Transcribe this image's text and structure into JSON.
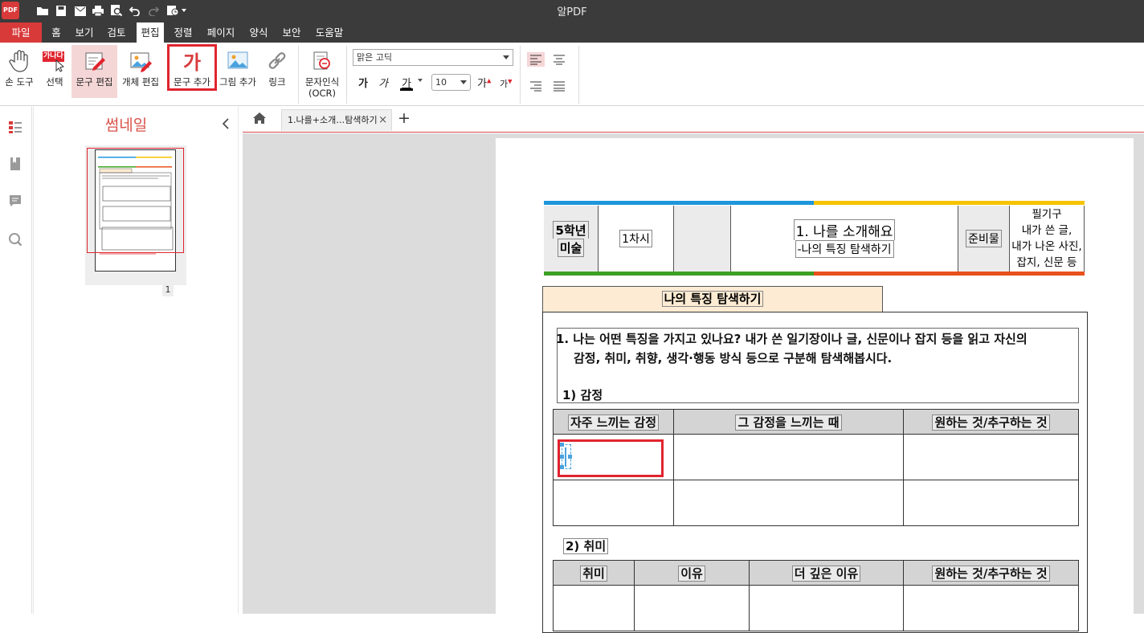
{
  "app": {
    "logo_text": "PDF",
    "title": "알PDF"
  },
  "menu": {
    "items": [
      "파일",
      "홈",
      "보기",
      "검토",
      "편집",
      "정렬",
      "페이지",
      "양식",
      "보안",
      "도움말"
    ],
    "active": "편집"
  },
  "ribbon": {
    "hand_tool": "손 도구",
    "select": "선택",
    "select_badge": "가나다",
    "text_edit": "문구 편집",
    "object_edit": "개체 편집",
    "add_text": "문구 추가",
    "add_text_glyph": "가",
    "add_image": "그림 추가",
    "link": "링크",
    "ocr_line1": "문자인식",
    "ocr_line2": "(OCR)",
    "font_name": "맑은 고딕",
    "font_size": "10",
    "bold_glyph": "가",
    "italic_glyph": "가",
    "underline_glyph": "가",
    "grow_glyph": "가",
    "shrink_glyph": "가"
  },
  "sidebar": {
    "title": "썸네일",
    "page_number": "1"
  },
  "tabs": {
    "doc_tab": "1.나를+소개…탐색하기",
    "close_glyph": "×",
    "add_glyph": "+"
  },
  "document": {
    "grade_line1": "5학년",
    "grade_line2": "미술",
    "period": "1차시",
    "lesson_title": "1. 나를 소개해요",
    "lesson_subtitle": "-나의 특징 탐색하기",
    "materials_label": "준비물",
    "materials_line1": "필기구",
    "materials_line2": "내가 쓴 글,",
    "materials_line3": "내가 나온 사진,",
    "materials_line4": "잡지, 신문 등",
    "section_title": "나의 특징 탐색하기",
    "question_line1": "1. 나는 어떤 특징을 가지고 있나요? 내가 쓴 일기장이나 글, 신문이나 잡지 등을 읽고 자신의",
    "question_line2": "감정, 취미, 취향, 생각·행동 방식 등으로 구분해 탐색해봅시다.",
    "emotion_heading": "1) 감정",
    "emotion_cols": [
      "자주 느끼는 감정",
      "그 감정을 느끼는 때",
      "원하는 것/추구하는 것"
    ],
    "hobby_heading": "2) 취미",
    "hobby_cols": [
      "취미",
      "이유",
      "더 깊은 이유",
      "원하는 것/추구하는 것"
    ]
  },
  "colors": {
    "accent_red": "#d83a3a",
    "highlight_red": "#e0242e",
    "header_blue": "#1e96dc",
    "header_yellow": "#f5c300",
    "header_green": "#3ca024",
    "header_orange": "#e8501e"
  }
}
